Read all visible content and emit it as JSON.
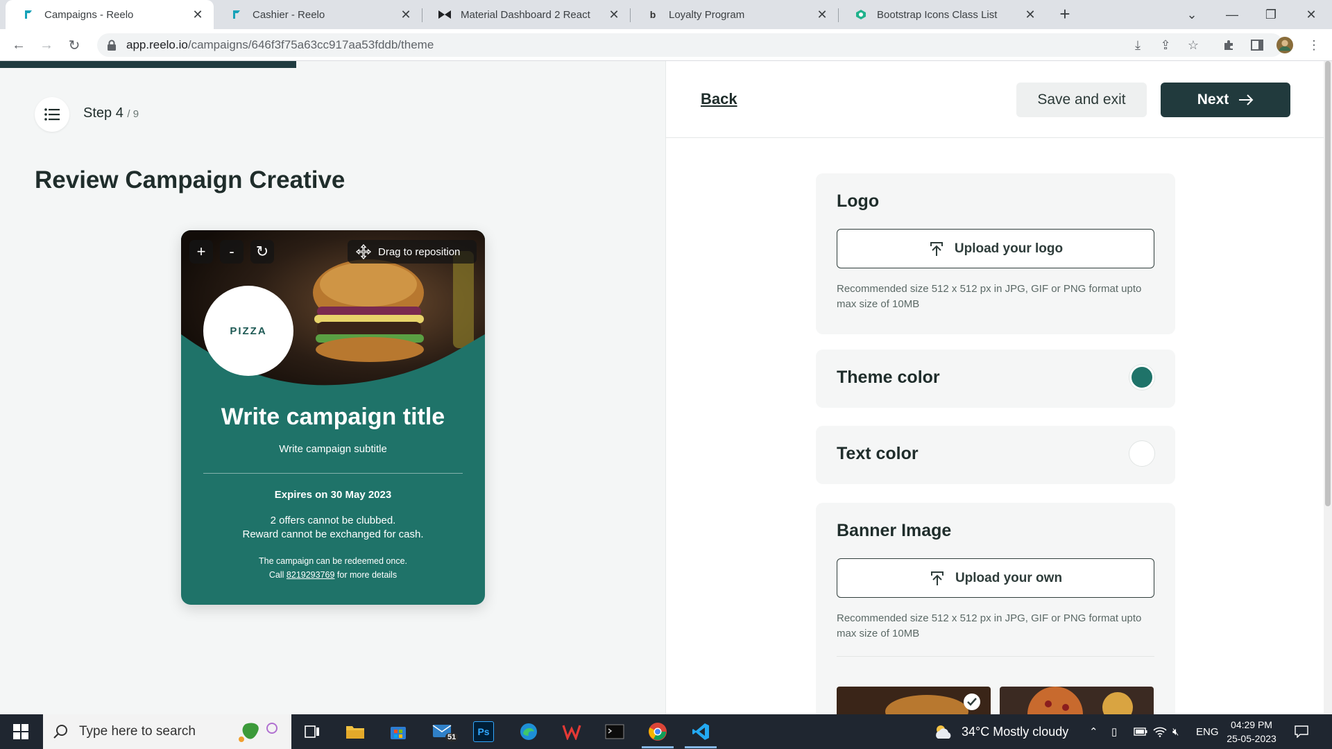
{
  "browser": {
    "tabs": [
      {
        "title": "Campaigns - Reelo",
        "icon": "reelo-icon",
        "active": true
      },
      {
        "title": "Cashier - Reelo",
        "icon": "reelo-icon",
        "active": false
      },
      {
        "title": "Material Dashboard 2 React",
        "icon": "material-icon",
        "active": false
      },
      {
        "title": "Loyalty Program",
        "icon": "loyalty-icon",
        "active": false
      },
      {
        "title": "Bootstrap Icons Class List",
        "icon": "bootstrap-icon",
        "active": false
      }
    ],
    "url_host": "app.reelo.io",
    "url_path": "/campaigns/646f3f75a63cc917aa53fddb/theme"
  },
  "step": {
    "current": "Step 4",
    "total": "/ 9",
    "progress_fraction": 0.444
  },
  "page_title": "Review Campaign Creative",
  "card": {
    "controls": {
      "zoom_in": "+",
      "zoom_out": "-",
      "reset": "↻",
      "drag_label": "Drag to reposition"
    },
    "logo_text": "PIZZA",
    "title": "Write campaign title",
    "subtitle": "Write campaign subtitle",
    "expiry": "Expires on 30 May 2023",
    "terms_line1": "2 offers cannot be clubbed.",
    "terms_line2": "Reward cannot be exchanged for cash.",
    "footer_line1": "The campaign can be redeemed once.",
    "footer_prefix": "Call ",
    "phone": "8219293769",
    "footer_suffix": " for more details"
  },
  "topbar": {
    "back": "Back",
    "save_exit": "Save and exit",
    "next": "Next"
  },
  "settings": {
    "logo": {
      "title": "Logo",
      "upload_label": "Upload your logo",
      "hint": "Recommended size 512 x 512 px in JPG, GIF or PNG format upto max size of 10MB"
    },
    "theme_color": {
      "title": "Theme color",
      "value": "#1f7369"
    },
    "text_color": {
      "title": "Text color",
      "value": "#ffffff"
    },
    "banner": {
      "title": "Banner Image",
      "upload_label": "Upload your own",
      "hint": "Recommended size 512 x 512 px in JPG, GIF or PNG format upto max size of 10MB"
    }
  },
  "taskbar": {
    "search_placeholder": "Type here to search",
    "mail_badge": "51",
    "weather": "34°C  Mostly cloudy",
    "language": "ENG",
    "time": "04:29 PM",
    "date": "25-05-2023"
  }
}
